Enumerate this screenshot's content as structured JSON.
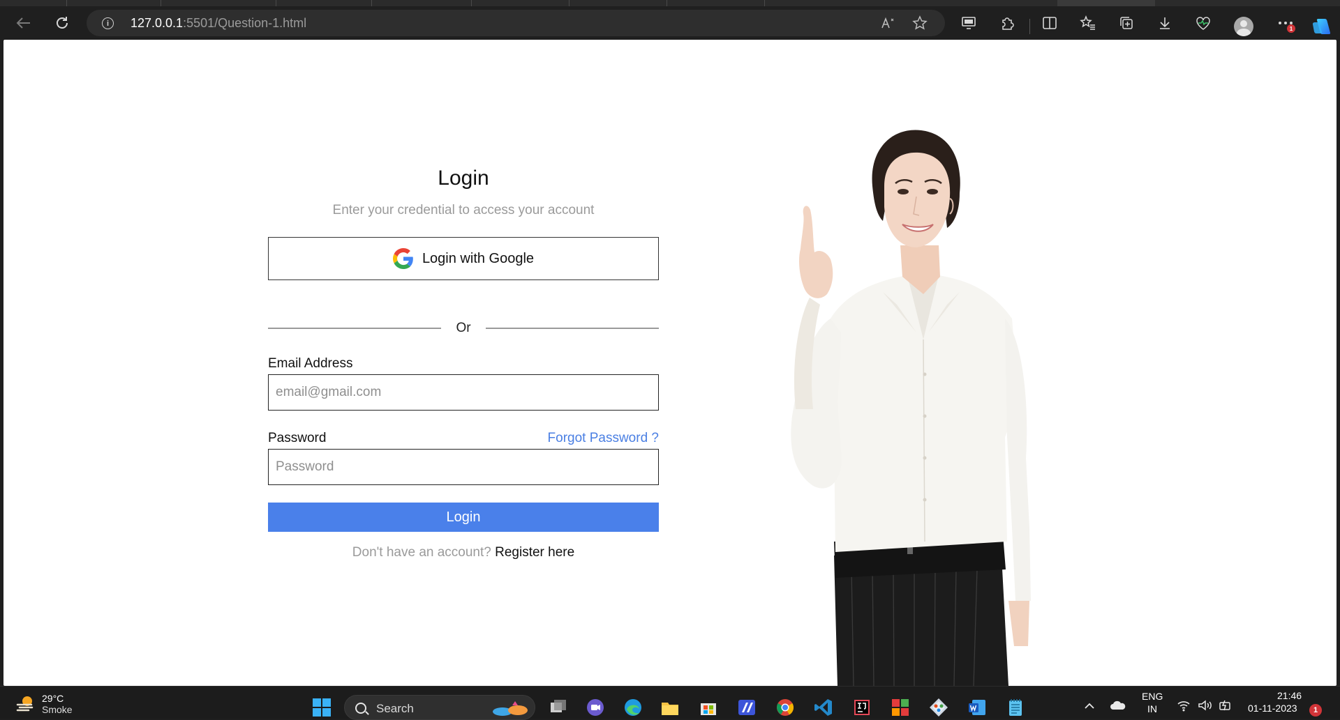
{
  "browser": {
    "url_host": "127.0.0.1",
    "url_path": ":5501/Question-1.html",
    "icons": [
      "back-arrow-icon",
      "refresh-icon",
      "info-icon",
      "read-aloud-icon",
      "favorite-star-icon",
      "app-available-icon",
      "extensions-icon",
      "split-screen-icon",
      "favorites-icon",
      "collections-icon",
      "downloads-icon",
      "browser-essentials-icon",
      "profile-icon",
      "more-menu-icon",
      "copilot-icon"
    ],
    "menu_badge": "1"
  },
  "login": {
    "title": "Login",
    "subtitle": "Enter your credential to access your account",
    "google_button": "Login with Google",
    "divider": "Or",
    "email_label": "Email Address",
    "email_placeholder": "email@gmail.com",
    "password_label": "Password",
    "forgot_link": "Forgot Password ?",
    "password_placeholder": "Password",
    "submit_button": "Login",
    "register_prompt": "Don't have an account?",
    "register_link": "Register here"
  },
  "colors": {
    "primary": "#4a80ea",
    "link": "#4a7fe3",
    "muted_text": "#9a9a9a"
  },
  "taskbar": {
    "weather_temp": "29°C",
    "weather_condition": "Smoke",
    "search_label": "Search",
    "language": "ENG",
    "region": "IN",
    "time": "21:46",
    "date": "01-11-2023",
    "notification_count": "1",
    "apps": [
      "windows-start-icon",
      "search-icon",
      "task-view-icon",
      "teams-icon",
      "edge-icon",
      "file-explorer-icon",
      "store-icon",
      "app-icon",
      "chrome-icon",
      "vscode-icon",
      "intellij-icon",
      "app-icon",
      "git-icon",
      "word-icon",
      "notepad-icon"
    ]
  }
}
